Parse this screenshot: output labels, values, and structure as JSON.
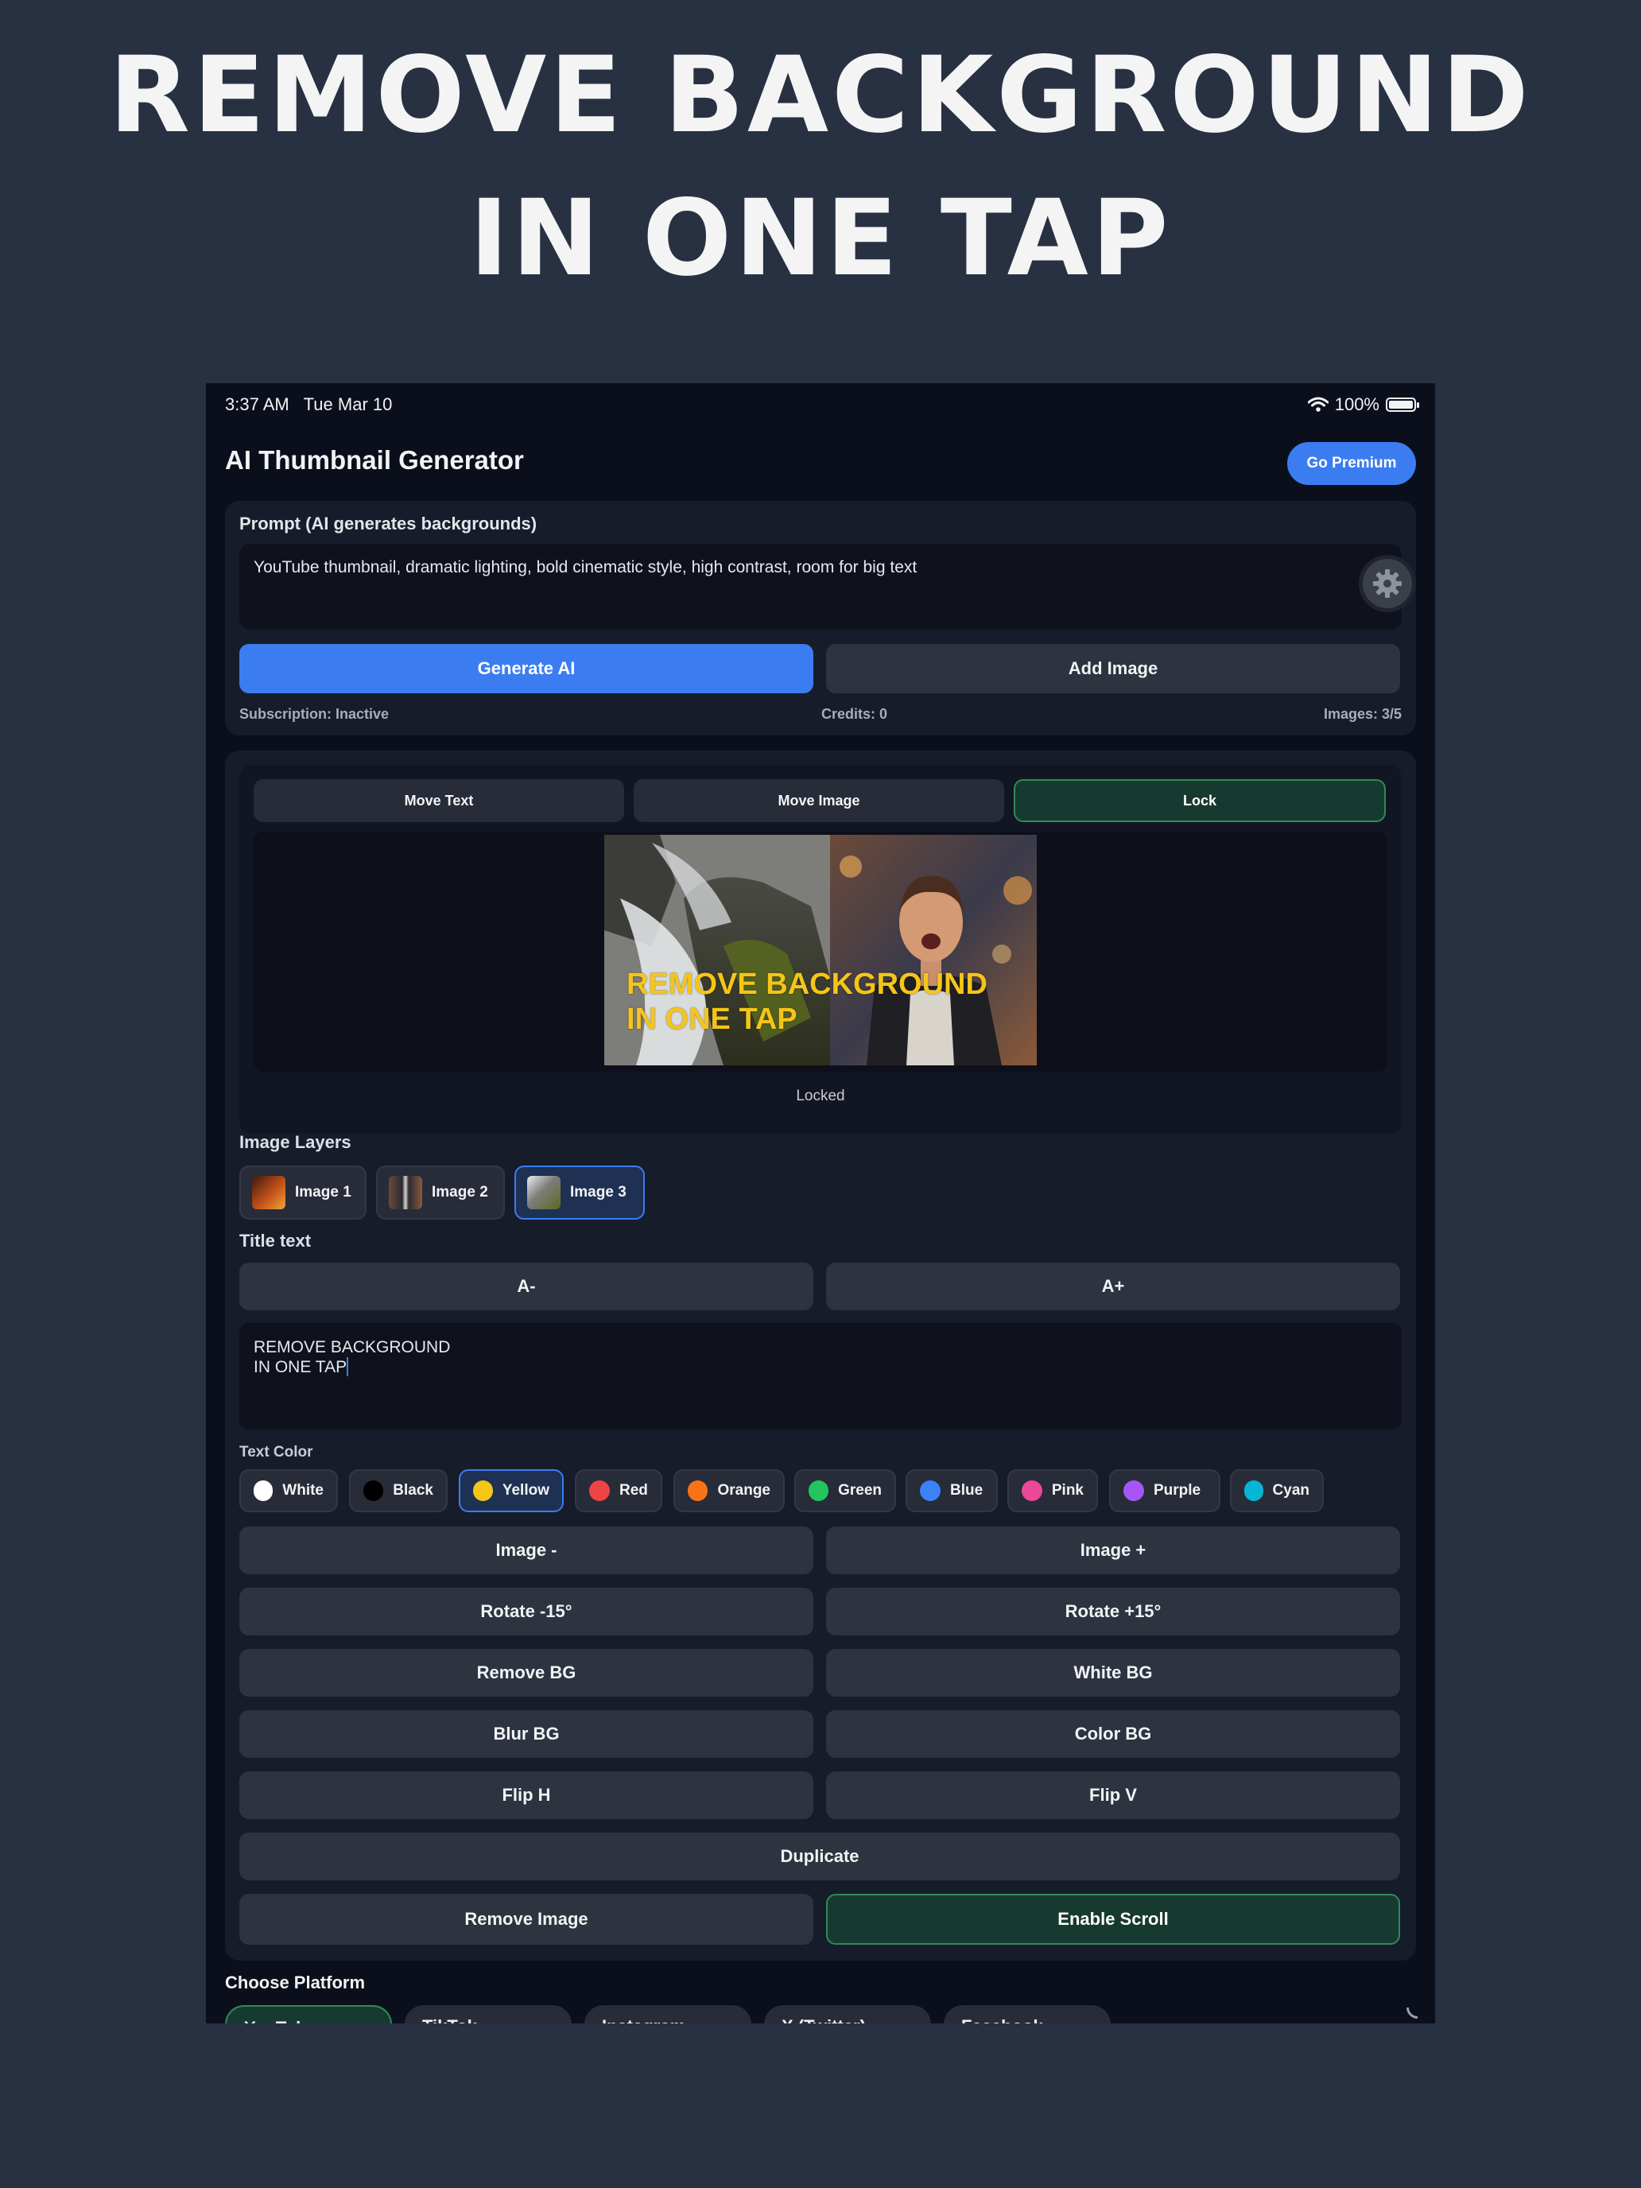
{
  "headline": {
    "line1": "REMOVE BACKGROUND",
    "line2": "IN ONE TAP"
  },
  "status": {
    "time": "3:37 AM",
    "date": "Tue Mar 10",
    "battery": "100%"
  },
  "app": {
    "title": "AI Thumbnail Generator",
    "premium_label": "Go Premium"
  },
  "prompt": {
    "label": "Prompt (AI generates backgrounds)",
    "value": "YouTube thumbnail, dramatic lighting, bold cinematic style, high contrast, room for big text",
    "generate_label": "Generate AI",
    "add_image_label": "Add Image"
  },
  "info": {
    "subscription": "Subscription: Inactive",
    "credits": "Credits: 0",
    "images": "Images: 3/5"
  },
  "canvas": {
    "modes": [
      "Move Text",
      "Move Image",
      "Lock"
    ],
    "active_mode": "Lock",
    "thumb_title_line1": "REMOVE BACKGROUND",
    "thumb_title_line2": "IN ONE TAP",
    "state": "Locked"
  },
  "layers": {
    "label": "Image Layers",
    "items": [
      "Image 1",
      "Image 2",
      "Image 3"
    ],
    "active": "Image 3"
  },
  "title_text": {
    "label": "Title text",
    "decrease": "A-",
    "increase": "A+",
    "value_line1": "REMOVE BACKGROUND",
    "value_line2": "IN ONE TAP"
  },
  "text_color": {
    "label": "Text Color",
    "options": [
      {
        "name": "White",
        "color": "#ffffff"
      },
      {
        "name": "Black",
        "color": "#000000"
      },
      {
        "name": "Yellow",
        "color": "#f5c518"
      },
      {
        "name": "Red",
        "color": "#ef4444"
      },
      {
        "name": "Orange",
        "color": "#f97316"
      },
      {
        "name": "Green",
        "color": "#22c55e"
      },
      {
        "name": "Blue",
        "color": "#3b82f6"
      },
      {
        "name": "Pink",
        "color": "#ec4899"
      },
      {
        "name": "Purple",
        "color": "#a855f7"
      },
      {
        "name": "Cyan",
        "color": "#06b6d4"
      }
    ],
    "active": "Yellow"
  },
  "actions": {
    "image_minus": "Image -",
    "image_plus": "Image +",
    "rotate_minus": "Rotate -15°",
    "rotate_plus": "Rotate +15°",
    "remove_bg": "Remove BG",
    "white_bg": "White BG",
    "blur_bg": "Blur BG",
    "color_bg": "Color BG",
    "flip_h": "Flip H",
    "flip_v": "Flip V",
    "duplicate": "Duplicate",
    "remove_image": "Remove Image",
    "enable_scroll": "Enable Scroll"
  },
  "platform": {
    "label": "Choose Platform",
    "items": [
      "YouTube",
      "TikTok",
      "Instagram",
      "X (Twitter)",
      "Facebook"
    ],
    "active": "YouTube"
  },
  "colors": {
    "accent": "#3b7df0",
    "active_green": "#173a30",
    "title_yellow": "#f5c518"
  }
}
